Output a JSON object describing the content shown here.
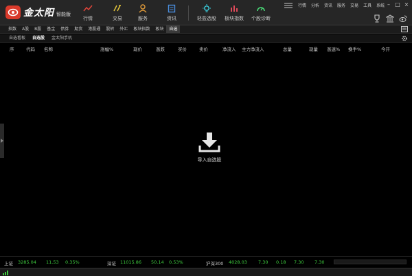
{
  "app": {
    "logo_text": "金太阳",
    "edition": "智能版"
  },
  "main_nav": [
    {
      "label": "行情",
      "icon": "chart-line-icon",
      "color": "#e0453a"
    },
    {
      "label": "交易",
      "icon": "trade-icon",
      "color": "#e0c23a"
    },
    {
      "label": "服务",
      "icon": "person-service-icon",
      "color": "#e09a3a"
    },
    {
      "label": "资讯",
      "icon": "news-icon",
      "color": "#4a8fe0"
    },
    {
      "label": "轻盈选股",
      "icon": "bulb-icon",
      "color": "#3ad0e0"
    },
    {
      "label": "板块指数",
      "icon": "bar-index-icon",
      "color": "#e04a5a"
    },
    {
      "label": "个股诊断",
      "icon": "gauge-icon",
      "color": "#4ae07a"
    }
  ],
  "top_links": [
    "行情",
    "分析",
    "资讯",
    "服务",
    "交易",
    "工具",
    "系统"
  ],
  "category_tabs": [
    "指数",
    "A股",
    "B股",
    "基金",
    "债券",
    "期货",
    "港股通",
    "股转",
    "外汇",
    "板块指数",
    "板块",
    "自选"
  ],
  "active_category": "自选",
  "sub_tabs": [
    "自选看板",
    "自选股",
    "金太阳手机"
  ],
  "active_sub_tab": "自选股",
  "columns": [
    "序",
    "代码",
    "名称",
    "涨幅%",
    "现价",
    "涨跌",
    "买价",
    "卖价",
    "净流入",
    "主力净流入",
    "总量",
    "现量",
    "涨速%",
    "换手%",
    "今开"
  ],
  "empty_state": {
    "label": "导入自选股"
  },
  "ticker": {
    "sh": {
      "name": "上证",
      "value": "3285.04",
      "change": "11.53",
      "pct": "0.35%"
    },
    "sz": {
      "name": "深证",
      "value": "11015.86",
      "change": "50.14",
      "pct": "0.53%"
    },
    "hs300": {
      "name": "沪深300",
      "value": "4028.03",
      "a": "7.30",
      "b": "0.18",
      "c": "7.30",
      "d": "7.30"
    }
  },
  "colors": {
    "up": "#3ec93e",
    "background": "#000000",
    "brand": "#d93a2b"
  }
}
